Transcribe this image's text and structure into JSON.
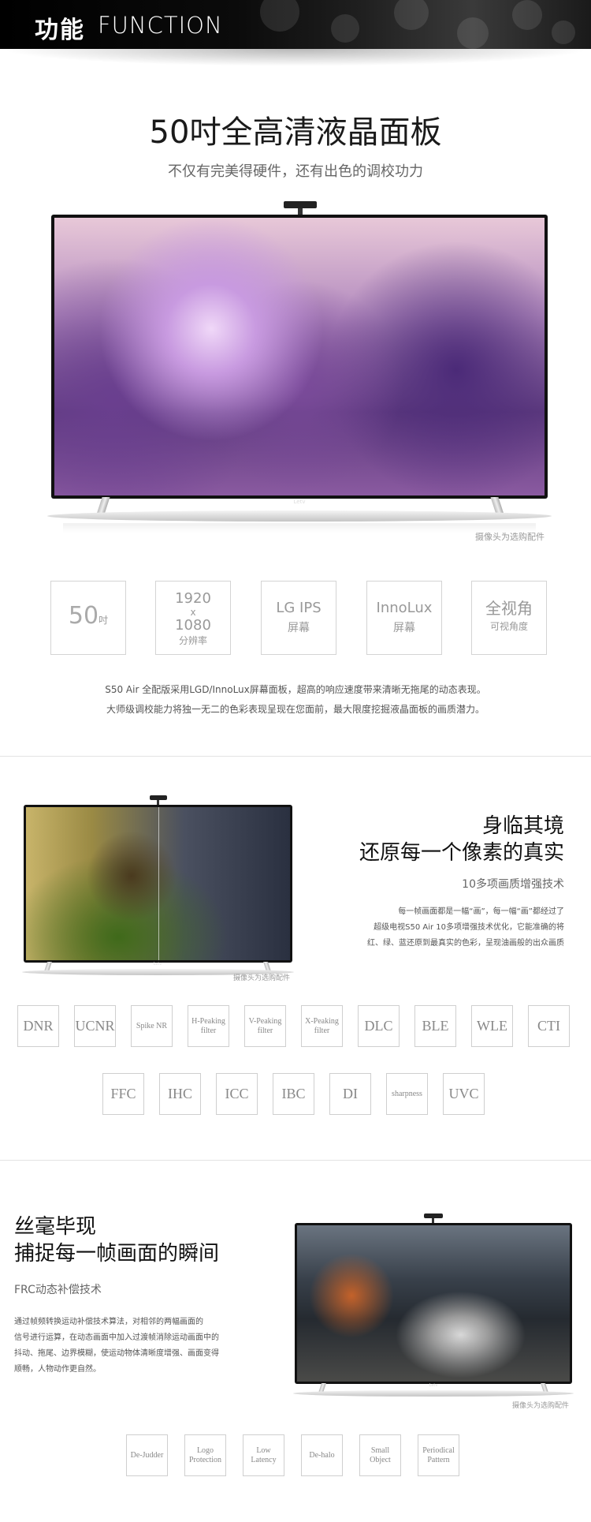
{
  "header": {
    "title_cn": "功能",
    "title_en": "FUNCTION"
  },
  "panel_section": {
    "title": "50吋全高清液晶面板",
    "subtitle": "不仅有完美得硬件，还有出色的调校功力",
    "tv_logo": "Letv",
    "caption": "摄像头为选购配件",
    "features": [
      {
        "main": "50",
        "unit": "吋"
      },
      {
        "line1": "1920",
        "line2": "x",
        "line3": "1080",
        "line4": "分辨率"
      },
      {
        "main": "LG IPS",
        "sub": "屏幕"
      },
      {
        "main": "InnoLux",
        "sub": "屏幕"
      },
      {
        "main": "全视角",
        "sub": "可视角度"
      }
    ],
    "desc_line1": "S50 Air 全配版采用LGD/InnoLux屏幕面板，超高的响应速度带来清晰无拖尾的动态表现。",
    "desc_line2": "大师级调校能力将独一无二的色彩表现呈现在您面前，最大限度挖掘液晶面板的画质潜力。"
  },
  "pixel_section": {
    "heading_line1": "身临其境",
    "heading_line2": "还原每一个像素的真实",
    "tag": "10多项画质增强技术",
    "para_line1": "每一帧画面都是一幅“画”，每一幅“画”都经过了",
    "para_line2": "超级电视S50 Air 10多项增强技术优化，它能准确的将",
    "para_line3": "红、绿、蓝还原到最真实的色彩，呈现油画般的出众画质",
    "tv_logo": "Letv",
    "caption": "摄像头为选购配件",
    "row1": [
      "DNR",
      "UCNR",
      "Spike  NR",
      "H-Peaking filter",
      "V-Peaking filter",
      "X-Peaking filter",
      "DLC",
      "BLE",
      "WLE",
      "CTI"
    ],
    "row2": [
      "FFC",
      "IHC",
      "ICC",
      "IBC",
      "DI",
      "sharpness",
      "UVC"
    ]
  },
  "frc_section": {
    "heading_line1": "丝毫毕现",
    "heading_line2": "捕捉每一帧画面的瞬间",
    "tag": "FRC动态补偿技术",
    "para_line1": "通过帧频转换运动补偿技术算法，对相邻的两幅画面的",
    "para_line2": "信号进行运算，在动态画面中加入过渡帧消除运动画面中的",
    "para_line3": "抖动、拖尾、边界模糊，使运动物体清晰度增强、画面变得",
    "para_line4": "顺畅，人物动作更自然。",
    "tv_logo": "Letv",
    "caption": "摄像头为选购配件",
    "chips": [
      "De-Judder",
      "Logo Protection",
      "Low Latency",
      "De-halo",
      "Small Object",
      "Periodical Pattern"
    ]
  }
}
